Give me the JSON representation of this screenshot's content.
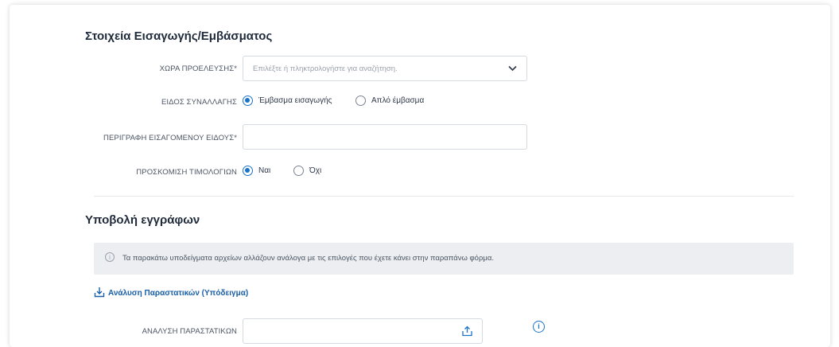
{
  "section1": {
    "title": "Στοιχεία Εισαγωγής/Εμβάσματος",
    "country": {
      "label": "ΧΩΡΑ ΠΡΟΕΛΕΥΣΗΣ*",
      "placeholder": "Επιλέξτε ή πληκτρολογήστε για αναζήτηση.",
      "icon": "chevron-down-icon"
    },
    "transaction_type": {
      "label": "ΕΙΔΟΣ ΣΥΝΑΛΛΑΓΗΣ",
      "options": [
        "Έμβασμα εισαγωγής",
        "Απλό έμβασμα"
      ],
      "selected": "Έμβασμα εισαγωγής"
    },
    "description": {
      "label": "ΠΕΡΙΓΡΑΦΗ ΕΙΣΑΓΟΜΕΝΟΥ ΕΙΔΟΥΣ*",
      "value": ""
    },
    "invoices": {
      "label": "ΠΡΟΣΚΟΜΙΣΗ ΤΙΜΟΛΟΓΙΩΝ",
      "options": [
        "Ναι",
        "Όχι"
      ],
      "selected": "Ναι"
    }
  },
  "section2": {
    "title": "Υποβολή εγγράφων",
    "info_text": "Τα παρακάτω υποδείγματα αρχείων αλλάζουν ανάλογα με τις επιλογές που έχετε κάνει στην παραπάνω φόρμα.",
    "template_link": "Ανάλυση Παραστατικών (Υπόδειγμα)",
    "upload": {
      "label": "ΑΝΑΛΥΣΗ ΠΑΡΑΣΤΑΤΙΚΩΝ",
      "value": ""
    }
  },
  "colors": {
    "accent": "#1a73c9",
    "link": "#1a5fa8",
    "info_bg": "#eceef1"
  }
}
